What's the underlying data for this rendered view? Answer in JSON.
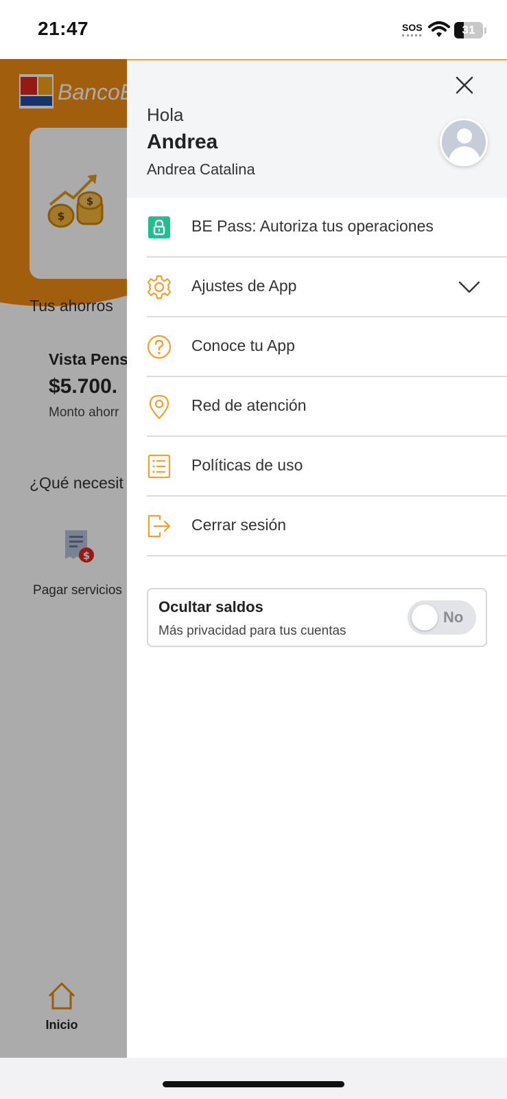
{
  "status_bar": {
    "time": "21:47",
    "sos": "SOS",
    "battery": "31",
    "icons": [
      "wifi-icon",
      "battery-icon"
    ]
  },
  "background": {
    "bank_name": "BancoE",
    "savings_title": "Tus ahorros",
    "account": {
      "name": "Vista Pens",
      "amount": "$5.700.",
      "label": "Monto ahorr"
    },
    "need_title": "¿Qué necesit",
    "service": {
      "label": "Pagar servicios"
    },
    "tab": {
      "label": "Inicio"
    },
    "colors": {
      "brand_orange": "#f08c14"
    }
  },
  "drawer": {
    "greeting": "Hola",
    "first_name": "Andrea",
    "full_name": "Andrea Catalina",
    "menu_items": [
      {
        "label": "BE Pass: Autoriza tus operaciones",
        "icon": "lock-icon"
      },
      {
        "label": "Ajustes de App",
        "icon": "gear-icon",
        "expandable": true
      },
      {
        "label": "Conoce tu App",
        "icon": "question-icon"
      },
      {
        "label": "Red de atención",
        "icon": "location-pin-icon"
      },
      {
        "label": "Políticas de uso",
        "icon": "list-icon"
      },
      {
        "label": "Cerrar sesión",
        "icon": "logout-icon"
      }
    ],
    "privacy": {
      "title": "Ocultar saldos",
      "subtitle": "Más privacidad para tus cuentas",
      "toggle_label": "No",
      "enabled": false
    },
    "colors": {
      "icon_orange": "#f0a030",
      "icon_green": "#1fbf8f"
    }
  }
}
